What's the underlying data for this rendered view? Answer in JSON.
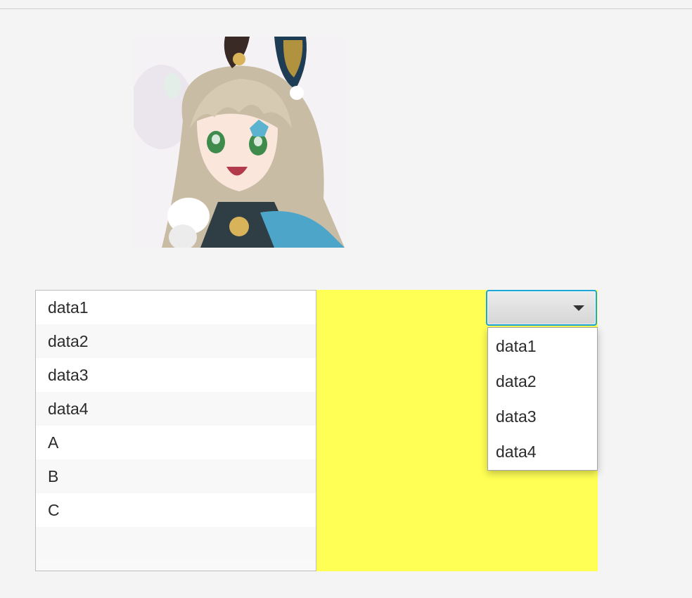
{
  "avatar": {
    "alt": "anime character portrait"
  },
  "list": {
    "items": [
      "data1",
      "data2",
      "data3",
      "data4",
      "A",
      "B",
      "C",
      ""
    ]
  },
  "pane": {
    "color": "#ffff55"
  },
  "combo": {
    "selected": "",
    "options": [
      "data1",
      "data2",
      "data3",
      "data4"
    ]
  }
}
